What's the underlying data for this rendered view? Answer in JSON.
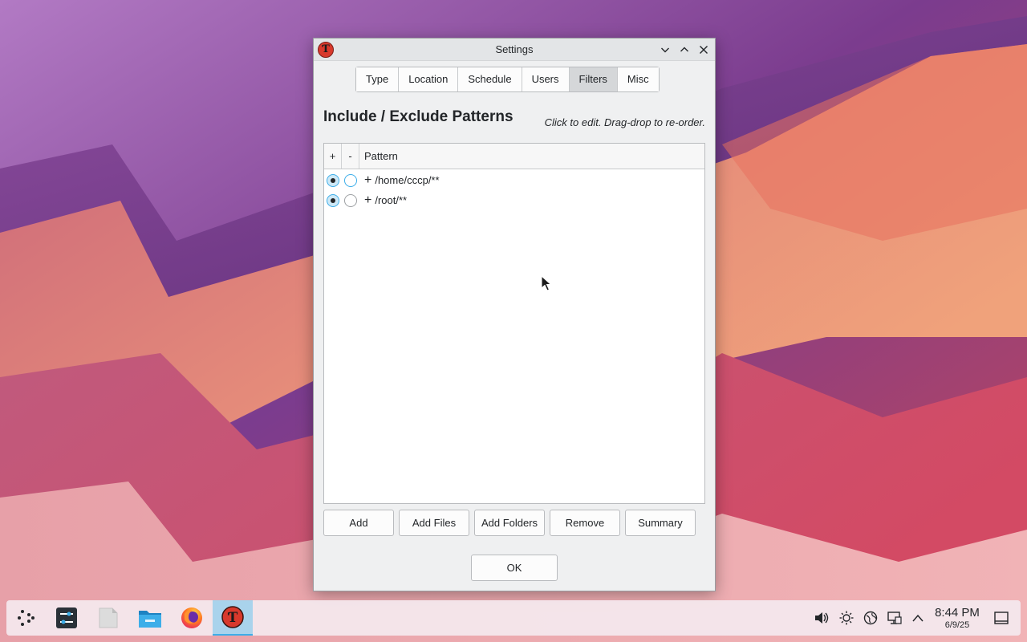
{
  "window": {
    "title": "Settings",
    "icon_name": "backup-app-icon",
    "controls": [
      "minimize-icon",
      "maximize-icon",
      "close-icon"
    ]
  },
  "tabs": [
    {
      "label": "Type",
      "active": false
    },
    {
      "label": "Location",
      "active": false
    },
    {
      "label": "Schedule",
      "active": false
    },
    {
      "label": "Users",
      "active": false
    },
    {
      "label": "Filters",
      "active": true
    },
    {
      "label": "Misc",
      "active": false
    }
  ],
  "filters": {
    "heading": "Include / Exclude Patterns",
    "hint": "Click to edit. Drag-drop to re-order.",
    "columns": {
      "include": "+",
      "exclude": "-",
      "pattern": "Pattern"
    },
    "rows": [
      {
        "include": true,
        "exclude": false,
        "sign": "+",
        "pattern": "/home/cccp/**"
      },
      {
        "include": true,
        "exclude": false,
        "sign": "+",
        "pattern": "/root/**"
      }
    ],
    "buttons": {
      "add": "Add",
      "add_files": "Add Files",
      "add_folders": "Add Folders",
      "remove": "Remove",
      "summary": "Summary"
    }
  },
  "ok_label": "OK",
  "taskbar": {
    "apps": [
      "launcher-icon",
      "system-settings-icon",
      "text-editor-icon",
      "file-manager-icon",
      "firefox-icon",
      "backup-app-icon"
    ],
    "tray": [
      "volume-icon",
      "brightness-icon",
      "network-icon",
      "display-icon",
      "expand-tray-icon"
    ],
    "time": "8:44 PM",
    "date": "6/9/25"
  },
  "colors": {
    "accent": "#3daee9",
    "active_tab": "#d5d7d9",
    "app_red": "#d8392c"
  }
}
